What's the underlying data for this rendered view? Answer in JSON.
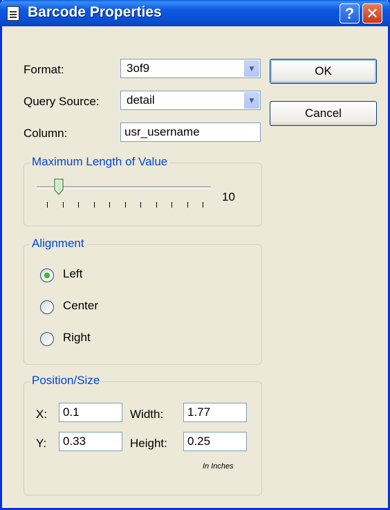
{
  "window": {
    "title": "Barcode Properties"
  },
  "fields": {
    "format": {
      "label": "Format:",
      "value": "3of9"
    },
    "query_source": {
      "label": "Query Source:",
      "value": "detail"
    },
    "column": {
      "label": "Column:",
      "value": "usr_username"
    }
  },
  "buttons": {
    "ok": "OK",
    "cancel": "Cancel"
  },
  "max_length": {
    "legend": "Maximum Length of Value",
    "value": "10",
    "tick_count": 11,
    "selected_tick": 2
  },
  "alignment": {
    "legend": "Alignment",
    "options": [
      {
        "label": "Left",
        "checked": true
      },
      {
        "label": "Center",
        "checked": false
      },
      {
        "label": "Right",
        "checked": false
      }
    ]
  },
  "position_size": {
    "legend": "Position/Size",
    "x": {
      "label": "X:",
      "value": "0.1"
    },
    "width": {
      "label": "Width:",
      "value": "1.77"
    },
    "y": {
      "label": "Y:",
      "value": "0.33"
    },
    "height": {
      "label": "Height:",
      "value": "0.25"
    },
    "note": "In Inches"
  },
  "colors": {
    "titlebar": "#0A4FD4",
    "legend": "#0046D5",
    "radio_checked": "#21A121"
  }
}
